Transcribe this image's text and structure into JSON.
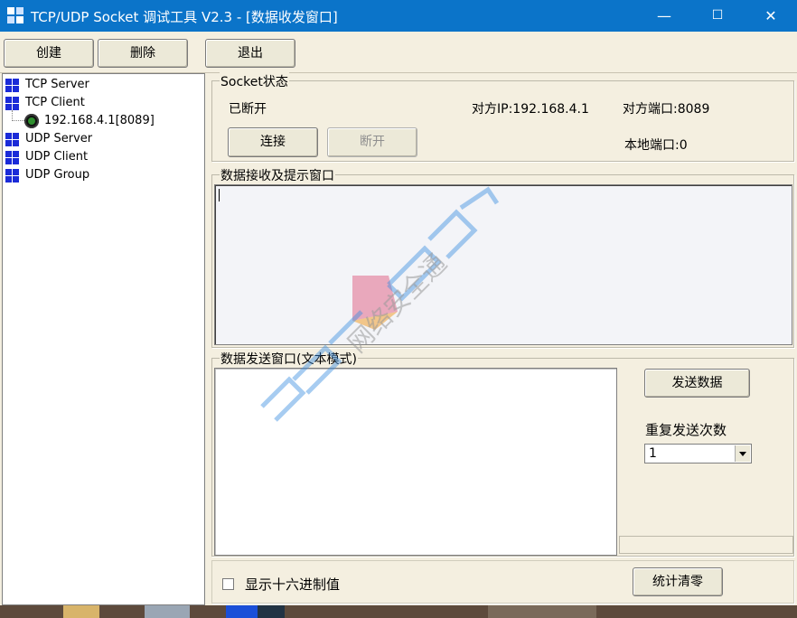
{
  "window": {
    "title": "TCP/UDP Socket 调试工具 V2.3 - [数据收发窗口]",
    "controls": {
      "minimize": "—",
      "maximize": "☐",
      "close": "✕"
    }
  },
  "toolbar": {
    "create_label": "创建",
    "delete_label": "删除",
    "exit_label": "退出"
  },
  "tree": {
    "items": [
      {
        "label": "TCP Server",
        "icon": "grid-icon"
      },
      {
        "label": "TCP Client",
        "icon": "grid-icon"
      },
      {
        "label": "192.168.4.1[8089]",
        "icon": "connection-status-icon"
      },
      {
        "label": "UDP Server",
        "icon": "grid-icon"
      },
      {
        "label": "UDP Client",
        "icon": "grid-icon"
      },
      {
        "label": "UDP Group",
        "icon": "grid-icon"
      }
    ]
  },
  "socket_status": {
    "group_label": "Socket状态",
    "state": "已断开",
    "remote_ip": "对方IP:192.168.4.1",
    "remote_port": "对方端口:8089",
    "local_port": "本地端口:0",
    "connect_label": "连接",
    "disconnect_label": "断开"
  },
  "receive": {
    "group_label": "数据接收及提示窗口",
    "content": ""
  },
  "send": {
    "group_label": "数据发送窗口(文本模式)",
    "content": "",
    "send_label": "发送数据",
    "repeat_label": "重复发送次数",
    "repeat_value": "1"
  },
  "bottom": {
    "hex_label": "显示十六进制值",
    "hex_checked": false,
    "clear_stats_label": "统计清零"
  },
  "watermark": {
    "text": "网络安全通",
    "brand_colors": [
      "#3c8fe0",
      "#f0a030",
      "#e04a6a"
    ]
  }
}
